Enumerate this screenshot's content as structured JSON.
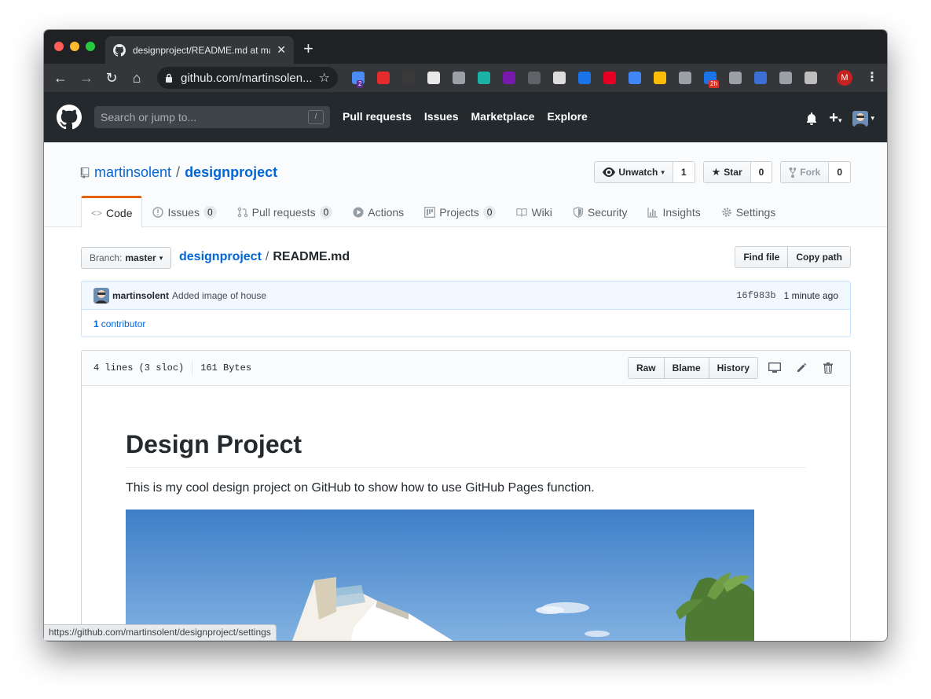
{
  "browser": {
    "tab_title": "designproject/README.md at ma",
    "url": "github.com/martinsolen...",
    "profile_initial": "M",
    "extensions": [
      {
        "name": "ext-octotree-icon",
        "color": "#4a8cf7",
        "badge": "2"
      },
      {
        "name": "ext-adblock-icon",
        "color": "#e52b2b"
      },
      {
        "name": "ext-imdb-icon",
        "color": "#3a3a3a"
      },
      {
        "name": "ext-sheets-icon",
        "color": "#e8e8e8"
      },
      {
        "name": "ext-keep-icon",
        "color": "#9aa0a6"
      },
      {
        "name": "ext-m-icon",
        "color": "#1bb3a6"
      },
      {
        "name": "ext-onenote-icon",
        "color": "#7719aa"
      },
      {
        "name": "ext-mercury-icon",
        "color": "#5f6368"
      },
      {
        "name": "ext-clapper-icon",
        "color": "#dddddd"
      },
      {
        "name": "ext-accessibility-icon",
        "color": "#1a73e8"
      },
      {
        "name": "ext-pinterest-icon",
        "color": "#e60023"
      },
      {
        "name": "ext-docs-icon",
        "color": "#4285f4"
      },
      {
        "name": "ext-chrome-icon",
        "color": "#fbbc05"
      },
      {
        "name": "ext-skype-icon",
        "color": "#9aa0a6"
      },
      {
        "name": "ext-calendar-icon",
        "color": "#1a73e8",
        "badge": "2h"
      },
      {
        "name": "ext-lightbulb-icon",
        "color": "#9aa0a6"
      },
      {
        "name": "ext-notes-icon",
        "color": "#3b6fd4"
      },
      {
        "name": "ext-camera-icon",
        "color": "#9aa0a6"
      },
      {
        "name": "ext-emoji-icon",
        "color": "#bdbdbd"
      }
    ]
  },
  "github": {
    "search_placeholder": "Search or jump to...",
    "search_key": "/",
    "nav": [
      "Pull requests",
      "Issues",
      "Marketplace",
      "Explore"
    ]
  },
  "repo": {
    "owner": "martinsolent",
    "name": "designproject",
    "watch_label": "Unwatch",
    "watch_count": "1",
    "star_label": "Star",
    "star_count": "0",
    "fork_label": "Fork",
    "fork_count": "0",
    "tabs": [
      {
        "label": "Code",
        "counter": null
      },
      {
        "label": "Issues",
        "counter": "0"
      },
      {
        "label": "Pull requests",
        "counter": "0"
      },
      {
        "label": "Actions",
        "counter": null
      },
      {
        "label": "Projects",
        "counter": "0"
      },
      {
        "label": "Wiki",
        "counter": null
      },
      {
        "label": "Security",
        "counter": null
      },
      {
        "label": "Insights",
        "counter": null
      },
      {
        "label": "Settings",
        "counter": null
      }
    ]
  },
  "file_nav": {
    "branch_label": "Branch:",
    "branch": "master",
    "root": "designproject",
    "separator": "/",
    "file": "README.md",
    "find_file": "Find file",
    "copy_path": "Copy path"
  },
  "commit": {
    "author": "martinsolent",
    "message": "Added image of house",
    "sha": "16f983b",
    "time": "1 minute ago",
    "contributors_count": "1",
    "contributors_label": "contributor"
  },
  "file": {
    "lines": "4 lines (3 sloc)",
    "size": "161 Bytes",
    "raw": "Raw",
    "blame": "Blame",
    "history": "History"
  },
  "readme": {
    "title": "Design Project",
    "paragraph": "This is my cool design project on GitHub to show how to use GitHub Pages function."
  },
  "status_bar": "https://github.com/martinsolent/designproject/settings"
}
